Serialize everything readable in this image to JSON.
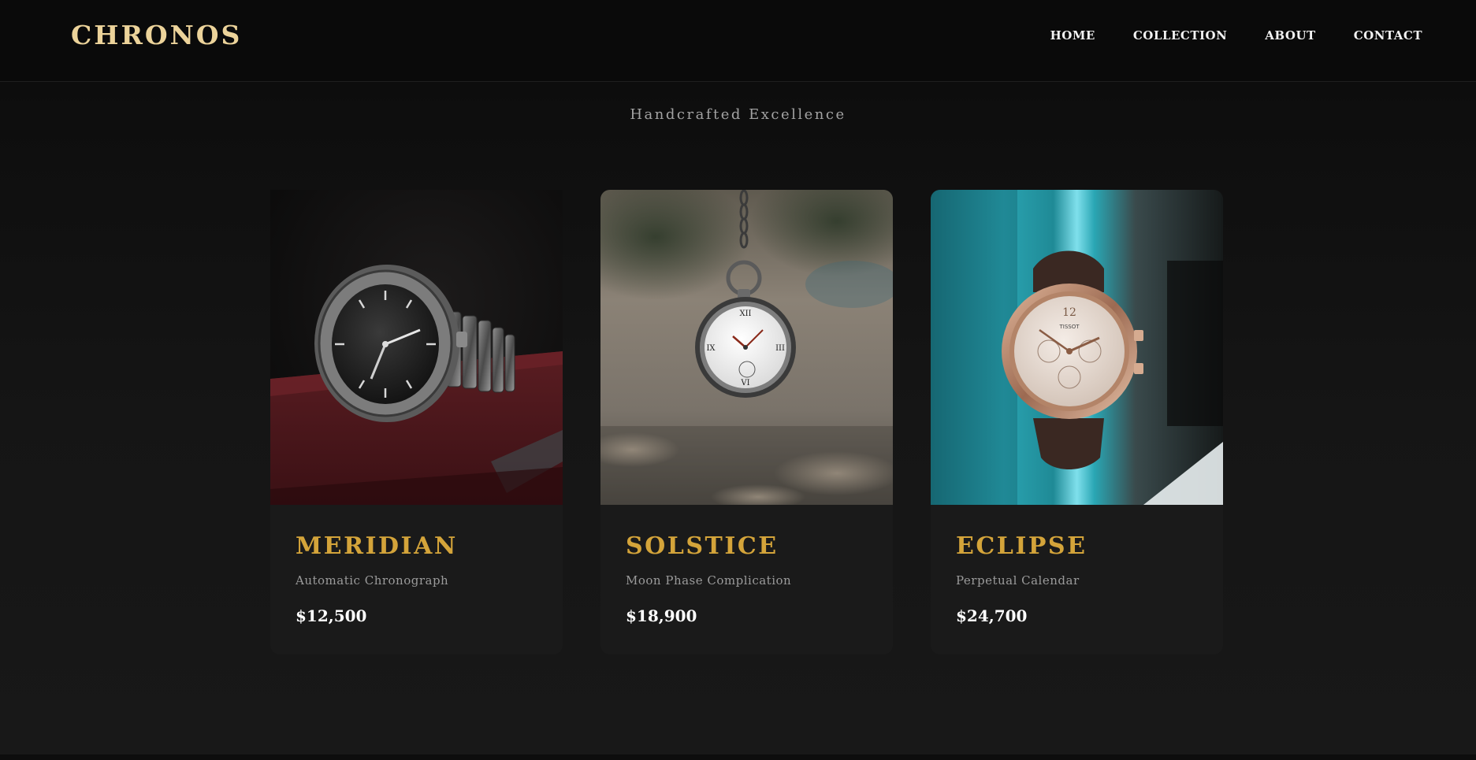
{
  "brand": {
    "logo": "CHRONOS",
    "logo_color": "#ecd39a",
    "accent_color": "#d4a43a"
  },
  "nav": {
    "items": [
      {
        "label": "HOME"
      },
      {
        "label": "COLLECTION"
      },
      {
        "label": "ABOUT"
      },
      {
        "label": "CONTACT"
      }
    ]
  },
  "hero": {
    "subtitle": "Handcrafted Excellence"
  },
  "collection": [
    {
      "name": "MERIDIAN",
      "description": "Automatic Chronograph",
      "price": "$12,500",
      "image": "steel-wristwatch-on-red-book"
    },
    {
      "name": "SOLSTICE",
      "description": "Moon Phase Complication",
      "price": "$18,900",
      "image": "hanging-pocket-watch"
    },
    {
      "name": "ECLIPSE",
      "description": "Perpetual Calendar",
      "price": "$24,700",
      "image": "rose-gold-chronograph-on-teal-fabric"
    }
  ]
}
